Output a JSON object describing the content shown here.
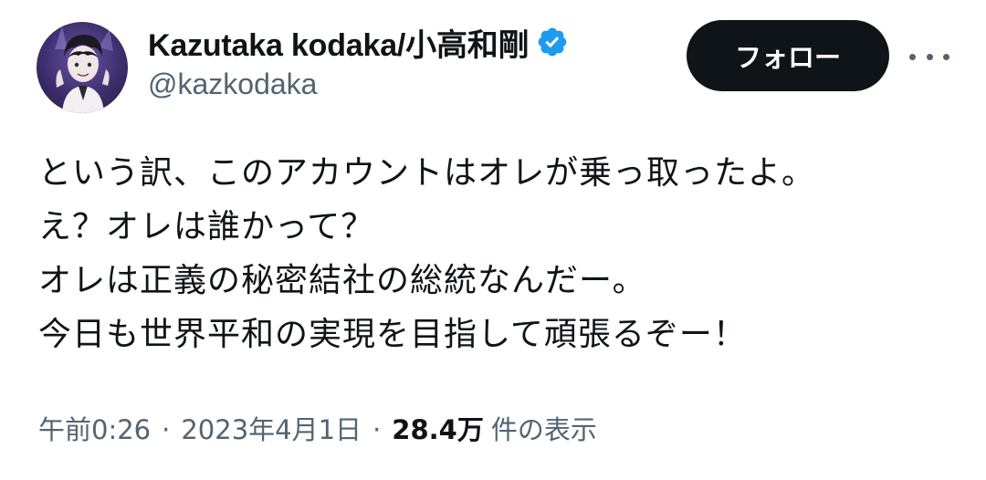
{
  "author": {
    "display_name": "Kazutaka kodaka/小高和剛",
    "handle": "@kazkodaka",
    "verified_icon": "verified-badge-icon",
    "avatar": "profile-avatar"
  },
  "actions": {
    "follow_label": "フォロー",
    "more_icon": "more-options-icon"
  },
  "tweet": {
    "lines": [
      "という訳、このアカウントはオレが乗っ取ったよ。",
      "え？オレは誰かって？",
      "オレは正義の秘密結社の総統なんだー。",
      "今日も世界平和の実現を目指して頑張るぞー！"
    ]
  },
  "meta": {
    "time": "午前0:26",
    "separator": "·",
    "date": "2023年4月1日",
    "views_count": "28.4万",
    "views_label": "件の表示"
  },
  "colors": {
    "text": "#0f1419",
    "secondary": "#536471",
    "verified": "#1d9bf0",
    "button_bg": "#0f1419",
    "button_text": "#ffffff"
  }
}
